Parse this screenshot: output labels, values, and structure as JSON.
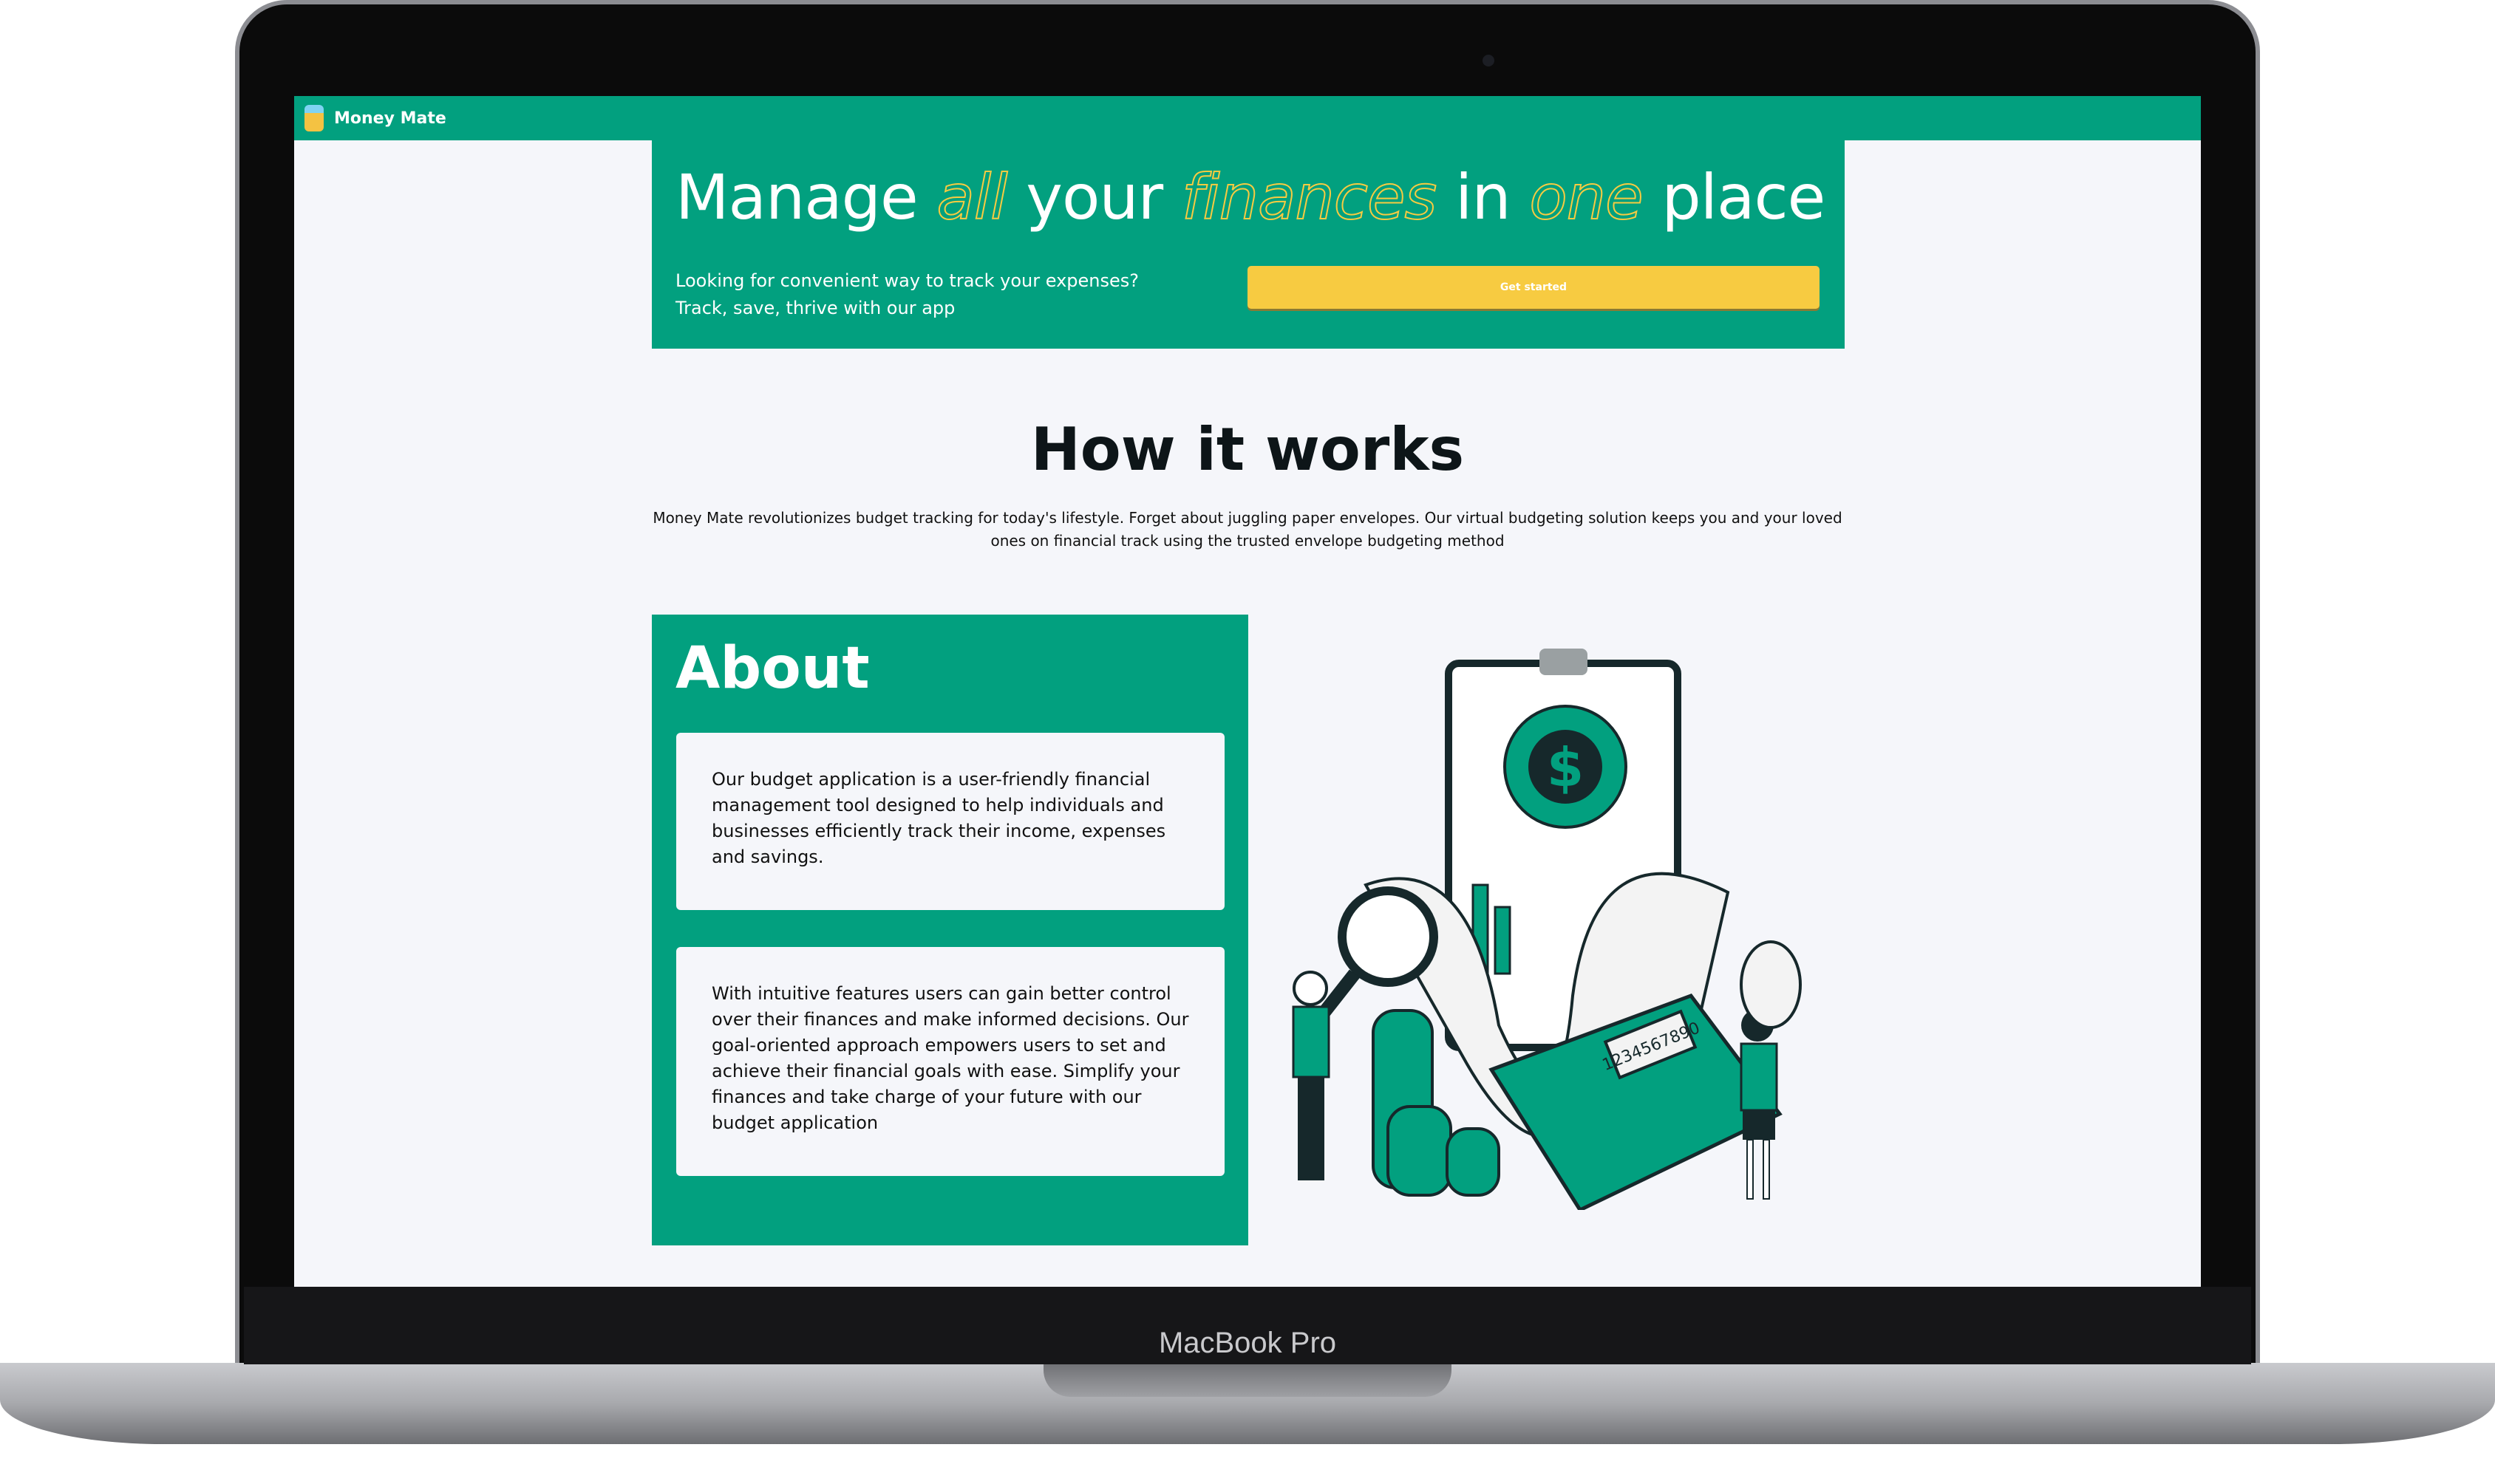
{
  "device": {
    "label": "MacBook Pro"
  },
  "nav": {
    "brand": "Money Mate"
  },
  "hero": {
    "title_parts": [
      "Manage",
      "all",
      "your",
      "finances",
      "in",
      "one",
      "place"
    ],
    "subtitle_line1": "Looking for convenient way to track your expenses?",
    "subtitle_line2": "Track, save, thrive with our app",
    "cta": "Get started"
  },
  "how": {
    "title": "How it works",
    "description": "Money Mate revolutionizes budget tracking for today's lifestyle. Forget about juggling paper envelopes. Our virtual budgeting solution keeps you and your loved ones on financial track using the trusted envelope budgeting method"
  },
  "about": {
    "title": "About",
    "card1": "Our budget application is a user-friendly financial management tool designed to help individuals and businesses efficiently track their income, expenses and savings.",
    "card2": "With intuitive features users can gain better control over their finances and make informed decisions. Our goal-oriented approach empowers users to set and achieve their financial goals with ease. Simplify your finances and take charge of your future with our budget application"
  },
  "illustration": {
    "calculator_display": "1234567890",
    "dollar_sign": "$"
  },
  "colors": {
    "brand": "#02a07f",
    "accent": "#f7cb41",
    "background": "#f5f6fa"
  }
}
